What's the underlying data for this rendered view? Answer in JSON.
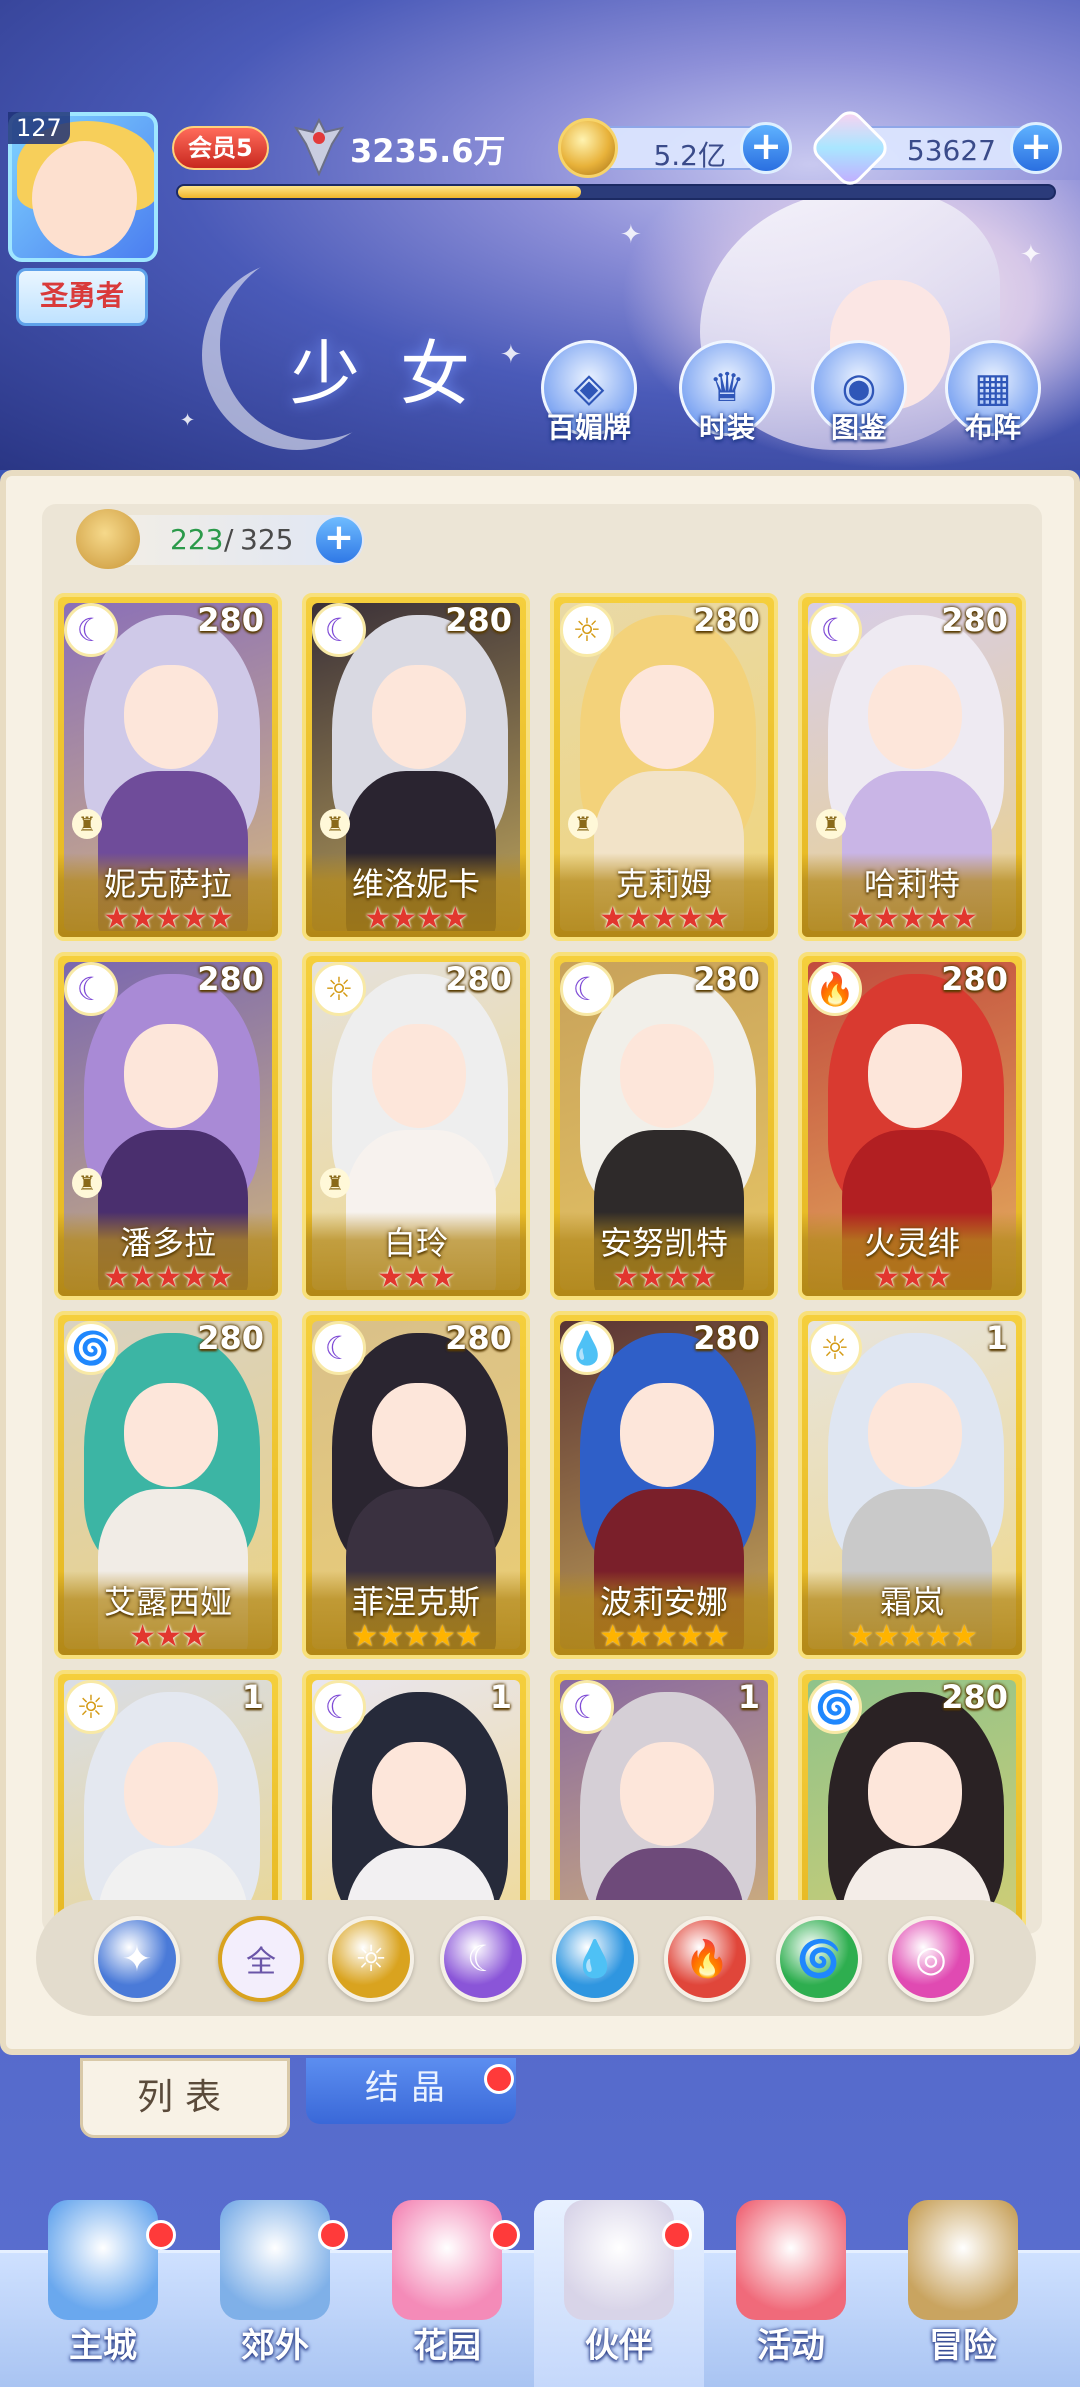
{
  "header": {
    "level": "127",
    "player_title": "圣勇者",
    "vip": "会员5",
    "power": "3235.6万",
    "exp_fraction": 0.46,
    "gold": "5.2亿",
    "gems": "53627",
    "page_title": "少女",
    "nav": [
      {
        "label": "百媚牌",
        "icon": "card-deck-icon"
      },
      {
        "label": "时装",
        "icon": "outfit-icon"
      },
      {
        "label": "图鉴",
        "icon": "codex-icon"
      },
      {
        "label": "布阵",
        "icon": "formation-icon"
      }
    ]
  },
  "roster": {
    "count_current": "223",
    "count_sep": "/",
    "count_total": "325"
  },
  "cards": [
    {
      "name": "妮克萨拉",
      "level": "280",
      "element": "moon",
      "stars": 5,
      "star_color": "red",
      "hair": "#cfc9e8",
      "body": "#6f4c9a",
      "bg": "#8a6fb8",
      "rook": true
    },
    {
      "name": "维洛妮卡",
      "level": "280",
      "element": "moon",
      "stars": 4,
      "star_color": "red",
      "hair": "#d9d9e2",
      "body": "#2a2430",
      "bg": "#3a3038",
      "rook": true
    },
    {
      "name": "克莉姆",
      "level": "280",
      "element": "sun",
      "stars": 5,
      "star_color": "red",
      "hair": "#f3d27a",
      "body": "#f2e3c8",
      "bg": "#e9d9a6",
      "rook": true
    },
    {
      "name": "哈莉特",
      "level": "280",
      "element": "moon",
      "stars": 5,
      "star_color": "red",
      "hair": "#eeeaf2",
      "body": "#c9b5e6",
      "bg": "#d7cde8",
      "rook": true
    },
    {
      "name": "潘多拉",
      "level": "280",
      "element": "moon",
      "stars": 5,
      "star_color": "red",
      "hair": "#a98ad6",
      "body": "#4a2f6e",
      "bg": "#7a67b0",
      "rook": true
    },
    {
      "name": "白玲",
      "level": "280",
      "element": "sun",
      "stars": 3,
      "star_color": "red",
      "hair": "#eeeeee",
      "body": "#f7f2ee",
      "bg": "#e5e1dc",
      "rook": true
    },
    {
      "name": "安努凯特",
      "level": "280",
      "element": "moon",
      "stars": 4,
      "star_color": "red",
      "hair": "#f1efe9",
      "body": "#2e2a2a",
      "bg": "#c8a25a",
      "rook": false
    },
    {
      "name": "火灵绯",
      "level": "280",
      "element": "fire",
      "stars": 3,
      "star_color": "red",
      "hair": "#d93a30",
      "body": "#b21f22",
      "bg": "#c24c3e",
      "rook": false
    },
    {
      "name": "艾露西娅",
      "level": "280",
      "element": "wind",
      "stars": 3,
      "star_color": "red",
      "hair": "#3cb5a4",
      "body": "#f1ece6",
      "bg": "#d9d2c2",
      "rook": false
    },
    {
      "name": "菲涅克斯",
      "level": "280",
      "element": "moon",
      "stars": 5,
      "star_color": "gold",
      "hair": "#2a2530",
      "body": "#3a3140",
      "bg": "#d9c08a",
      "rook": false
    },
    {
      "name": "波莉安娜",
      "level": "280",
      "element": "water",
      "stars": 5,
      "star_color": "gold",
      "hair": "#2f5fc8",
      "body": "#7a1f2a",
      "bg": "#5a3434",
      "rook": false
    },
    {
      "name": "霜岚",
      "level": "1",
      "element": "sun",
      "stars": 5,
      "star_color": "gold",
      "hair": "#dfe6f2",
      "body": "#c9c9c9",
      "bg": "#e7e4de",
      "rook": false
    },
    {
      "name": "",
      "level": "1",
      "element": "sun",
      "stars": 0,
      "star_color": "gold",
      "hair": "#e4e8f0",
      "body": "#f1f1f1",
      "bg": "#d9dde6",
      "rook": false
    },
    {
      "name": "",
      "level": "1",
      "element": "moon",
      "stars": 0,
      "star_color": "gold",
      "hair": "#262a3a",
      "body": "#f2f0f2",
      "bg": "#e9e6ef",
      "rook": false
    },
    {
      "name": "",
      "level": "1",
      "element": "moon",
      "stars": 0,
      "star_color": "gold",
      "hair": "#d5cfd6",
      "body": "#6e4a7a",
      "bg": "#8a6aa0",
      "rook": false
    },
    {
      "name": "",
      "level": "280",
      "element": "wind",
      "stars": 0,
      "star_color": "gold",
      "hair": "#2a2224",
      "body": "#f4ede8",
      "bg": "#8fc38a",
      "rook": false
    }
  ],
  "filters": [
    {
      "name": "filter-special-icon",
      "glyph": "✦",
      "color": "#4a7ad8",
      "label": ""
    },
    {
      "name": "filter-all",
      "glyph": "",
      "color": "#f4f0ff",
      "label": "全"
    },
    {
      "name": "filter-sun-icon",
      "glyph": "☼",
      "color": "#d9a31f",
      "label": ""
    },
    {
      "name": "filter-moon-icon",
      "glyph": "☾",
      "color": "#8a55d8",
      "label": ""
    },
    {
      "name": "filter-water-icon",
      "glyph": "💧",
      "color": "#2f96e0",
      "label": ""
    },
    {
      "name": "filter-fire-icon",
      "glyph": "🔥",
      "color": "#e0463a",
      "label": ""
    },
    {
      "name": "filter-wind-icon",
      "glyph": "🌀",
      "color": "#2eae4f",
      "label": ""
    },
    {
      "name": "filter-heart-icon",
      "glyph": "◎",
      "color": "#e04ab2",
      "label": ""
    }
  ],
  "tabs": {
    "list": "列表",
    "crystal": "结晶"
  },
  "bottom_nav": [
    {
      "label": "主城",
      "active": false,
      "dot": true,
      "color": "#6aa8ee"
    },
    {
      "label": "郊外",
      "active": false,
      "dot": true,
      "color": "#7fb0e8"
    },
    {
      "label": "花园",
      "active": false,
      "dot": true,
      "color": "#f48bb8"
    },
    {
      "label": "伙伴",
      "active": true,
      "dot": true,
      "color": "#d8d4e8"
    },
    {
      "label": "活动",
      "active": false,
      "dot": false,
      "color": "#f06a7a"
    },
    {
      "label": "冒险",
      "active": false,
      "dot": false,
      "color": "#c9a460"
    }
  ]
}
